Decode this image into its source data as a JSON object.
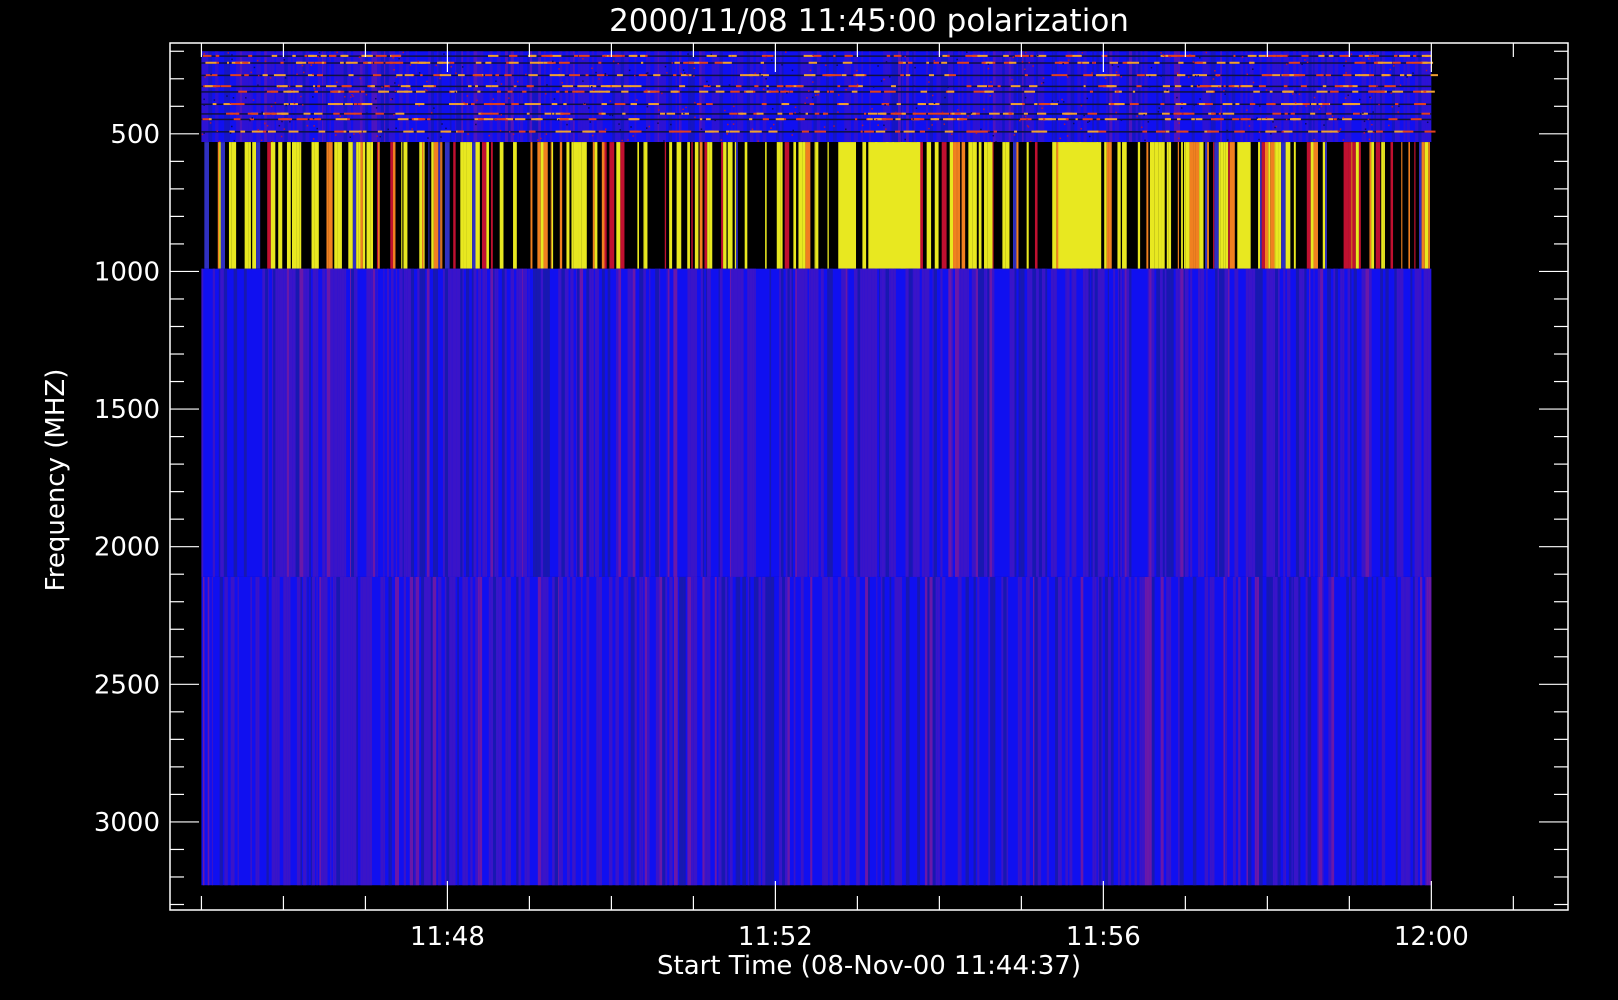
{
  "chart_data": {
    "type": "heatmap",
    "title": "2000/11/08 11:45:00 polarization",
    "xlabel": "Start Time (08-Nov-00 11:44:37)",
    "ylabel": "Frequency (MHZ)",
    "x_axis": {
      "unit": "time of day",
      "range": [
        "11:44:37",
        "12:01:40"
      ],
      "data_range": [
        "11:45:00",
        "12:00:00"
      ],
      "major_ticks": [
        "11:48",
        "11:52",
        "11:56",
        "12:00"
      ],
      "minor_tick_interval_min": 1
    },
    "y_axis": {
      "unit": "MHz",
      "reversed": true,
      "range": [
        170,
        3320
      ],
      "major_ticks": [
        500,
        1000,
        1500,
        2000,
        2500,
        3000
      ],
      "minor_tick_interval": 100
    },
    "bands": [
      {
        "freq_start_mhz": 200,
        "freq_end_mhz": 530,
        "pattern": "noisy blue with red/orange horizontal streaks"
      },
      {
        "freq_start_mhz": 530,
        "freq_end_mhz": 990,
        "pattern": "black with yellow/orange/red vertical stripes"
      },
      {
        "freq_start_mhz": 990,
        "freq_end_mhz": 2110,
        "pattern": "blue with faint purple vertical stripes"
      },
      {
        "freq_start_mhz": 2110,
        "freq_end_mhz": 3230,
        "pattern": "blue with faint purple vertical stripes"
      }
    ],
    "colormap": {
      "background": "#000000",
      "low": "#1010f0",
      "mid": "#c01030",
      "high": "#e8e820"
    },
    "grid": false,
    "legend": "none"
  }
}
